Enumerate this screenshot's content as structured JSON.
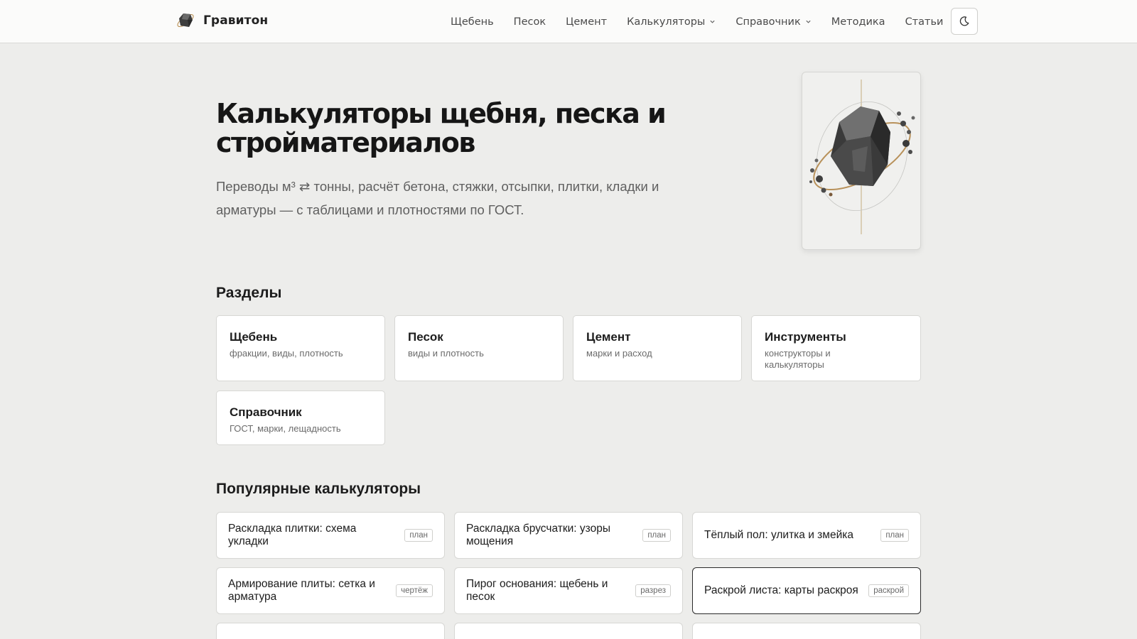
{
  "header": {
    "brand": "Гравитон",
    "nav": [
      {
        "label": "Щебень"
      },
      {
        "label": "Песок"
      },
      {
        "label": "Цемент"
      },
      {
        "label": "Калькуляторы",
        "dropdown": true
      },
      {
        "label": "Справочник",
        "dropdown": true
      },
      {
        "label": "Методика"
      },
      {
        "label": "Статьи"
      }
    ],
    "theme_icon": "moon-icon"
  },
  "hero": {
    "title": "Калькуляторы щебня, песка и стройматериалов",
    "subtitle": "Переводы м³ ⇄ тонны, расчёт бетона, стяжки, отсыпки, плитки, кладки и арматуры — с таблицами и плотностями по ГОСТ.",
    "image_icon": "rock-orbit-illustration"
  },
  "sections": {
    "heading": "Разделы",
    "items": [
      {
        "title": "Щебень",
        "desc": "фракции, виды, плотность"
      },
      {
        "title": "Песок",
        "desc": "виды и плотность"
      },
      {
        "title": "Цемент",
        "desc": "марки и расход"
      },
      {
        "title": "Инструменты",
        "desc": "конструкторы и калькуляторы"
      },
      {
        "title": "Справочник",
        "desc": "ГОСТ, марки, лещадность"
      }
    ]
  },
  "popular": {
    "heading": "Популярные калькуляторы",
    "items": [
      {
        "title": "Раскладка плитки: схема укладки",
        "tag": "план"
      },
      {
        "title": "Раскладка брусчатки: узоры мощения",
        "tag": "план"
      },
      {
        "title": "Тёплый пол: улитка и змейка",
        "tag": "план"
      },
      {
        "title": "Армирование плиты: сетка и арматура",
        "tag": "чертёж"
      },
      {
        "title": "Пирог основания: щебень и песок",
        "tag": "разрез"
      },
      {
        "title": "Раскрой листа: карты раскроя",
        "tag": "раскрой"
      }
    ]
  },
  "colors": {
    "background": "#ededeb",
    "header_bg": "#fbfbfa",
    "card_bg": "#ffffff",
    "text": "#1c1c1c",
    "muted": "#6b6b6b"
  }
}
